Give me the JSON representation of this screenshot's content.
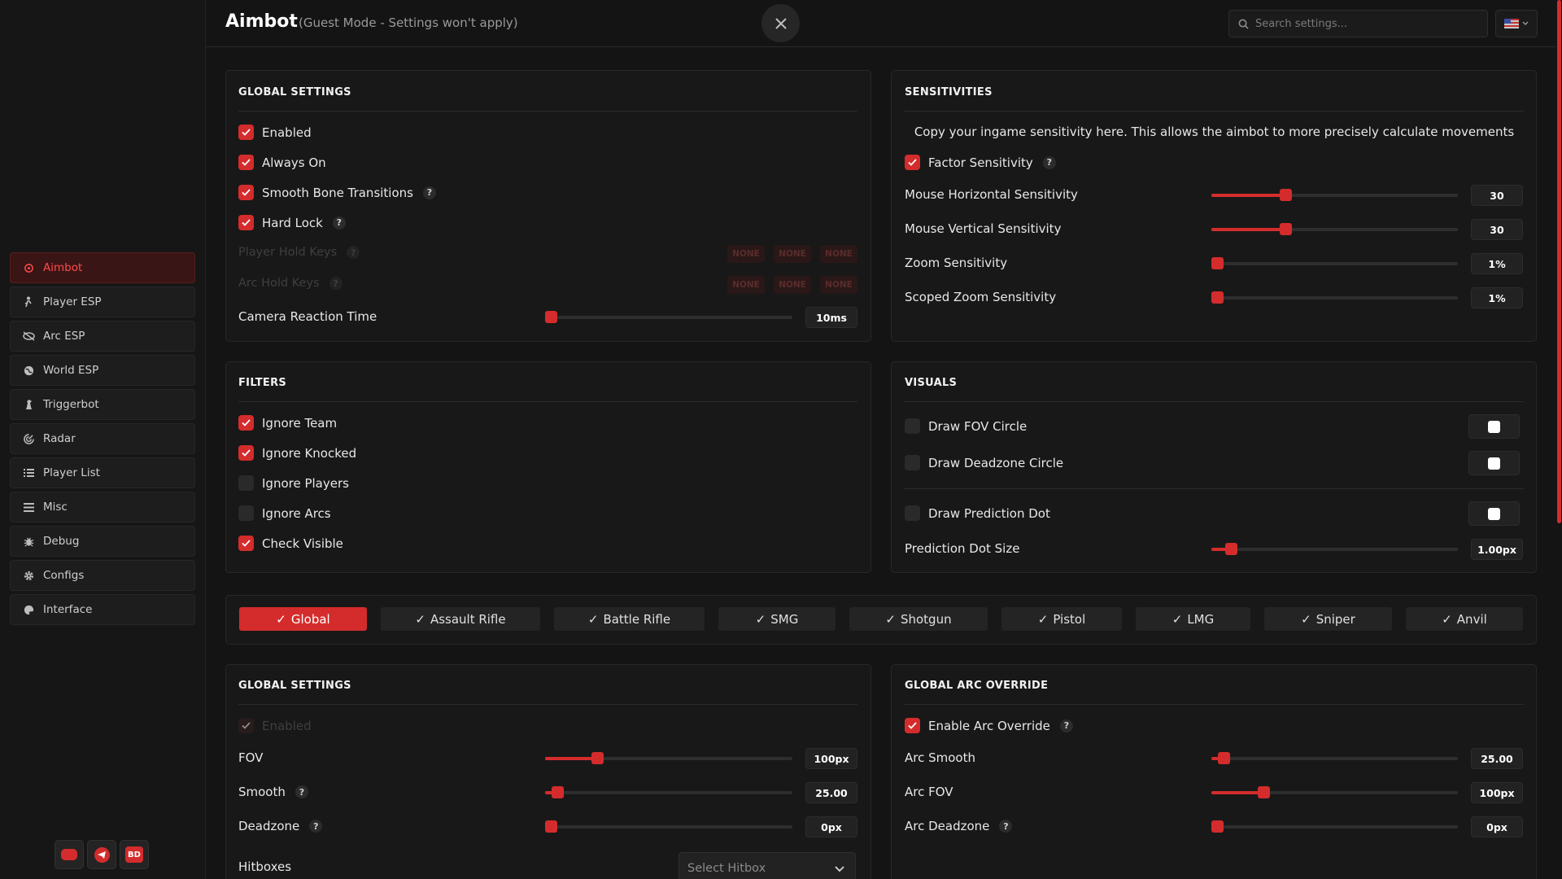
{
  "header": {
    "title": "Aimbot",
    "subtitle": "(Guest Mode - Settings won't apply)",
    "search_placeholder": "Search settings..."
  },
  "sidebar": {
    "items": [
      {
        "label": "Aimbot",
        "icon": "crosshair-icon"
      },
      {
        "label": "Player ESP",
        "icon": "person-icon"
      },
      {
        "label": "Arc ESP",
        "icon": "eye-slash-icon"
      },
      {
        "label": "World ESP",
        "icon": "globe-icon"
      },
      {
        "label": "Triggerbot",
        "icon": "chess-icon"
      },
      {
        "label": "Radar",
        "icon": "radar-icon"
      },
      {
        "label": "Player List",
        "icon": "list-icon"
      },
      {
        "label": "Misc",
        "icon": "menu-icon"
      },
      {
        "label": "Debug",
        "icon": "bug-icon"
      },
      {
        "label": "Configs",
        "icon": "gear-icon"
      },
      {
        "label": "Interface",
        "icon": "palette-icon"
      }
    ],
    "social": {
      "discord_icon": "discord-icon",
      "telegram_icon": "telegram-icon",
      "bd_label": "BD"
    }
  },
  "global_settings": {
    "title": "GLOBAL SETTINGS",
    "checks": [
      {
        "label": "Enabled",
        "checked": true
      },
      {
        "label": "Always On",
        "checked": true
      },
      {
        "label": "Smooth Bone Transitions",
        "checked": true
      },
      {
        "label": "Hard Lock",
        "checked": true
      }
    ],
    "player_hold_keys": "Player Hold Keys",
    "arc_hold_keys": "Arc Hold Keys",
    "key_none": "NONE",
    "camera_reaction_label": "Camera Reaction Time",
    "camera_reaction_value": "10ms",
    "camera_reaction_level": 0.0
  },
  "sensitivities": {
    "title": "SENSITIVITIES",
    "description": "Copy your ingame sensitivity here. This allows the aimbot to more precisely calculate movements",
    "factor_label": "Factor Sensitivity",
    "sliders": [
      {
        "label": "Mouse Horizontal Sensitivity",
        "value": "30",
        "level": 0.3
      },
      {
        "label": "Mouse Vertical Sensitivity",
        "value": "30",
        "level": 0.3
      },
      {
        "label": "Zoom Sensitivity",
        "value": "1%",
        "level": 0.0
      },
      {
        "label": "Scoped Zoom Sensitivity",
        "value": "1%",
        "level": 0.0
      }
    ]
  },
  "filters": {
    "title": "FILTERS",
    "checks": [
      {
        "label": "Ignore Team",
        "checked": true
      },
      {
        "label": "Ignore Knocked",
        "checked": true
      },
      {
        "label": "Ignore Players",
        "checked": false
      },
      {
        "label": "Ignore Arcs",
        "checked": false
      },
      {
        "label": "Check Visible",
        "checked": true
      }
    ]
  },
  "visuals": {
    "title": "VISUALS",
    "draw_fov": "Draw FOV Circle",
    "draw_deadzone": "Draw Deadzone Circle",
    "draw_prediction": "Draw Prediction Dot",
    "dot_size_label": "Prediction Dot Size",
    "dot_size_value": "1.00px",
    "dot_size_level": 0.08,
    "swatch_color": "#ffffff"
  },
  "tabs": [
    "Global",
    "Assault Rifle",
    "Battle Rifle",
    "SMG",
    "Shotgun",
    "Pistol",
    "LMG",
    "Sniper",
    "Anvil"
  ],
  "weapon_global": {
    "title": "GLOBAL SETTINGS",
    "enabled": "Enabled",
    "fov_label": "FOV",
    "fov_value": "100px",
    "fov_level": 0.21,
    "smooth_label": "Smooth",
    "smooth_value": "25.00",
    "smooth_level": 0.05,
    "deadzone_label": "Deadzone",
    "deadzone_value": "0px",
    "deadzone_level": 0.0,
    "hitboxes_label": "Hitboxes",
    "hitbox_placeholder": "Select Hitbox"
  },
  "arc_override": {
    "title": "GLOBAL ARC OVERRIDE",
    "enable_label": "Enable Arc Override",
    "smooth_label": "Arc Smooth",
    "smooth_value": "25.00",
    "smooth_level": 0.05,
    "fov_label": "Arc FOV",
    "fov_value": "100px",
    "fov_level": 0.21,
    "deadzone_label": "Arc Deadzone",
    "deadzone_value": "0px",
    "deadzone_level": 0.0
  },
  "colors": {
    "accent": "#d42c2c",
    "background": "#141414",
    "panel": "#181818"
  }
}
